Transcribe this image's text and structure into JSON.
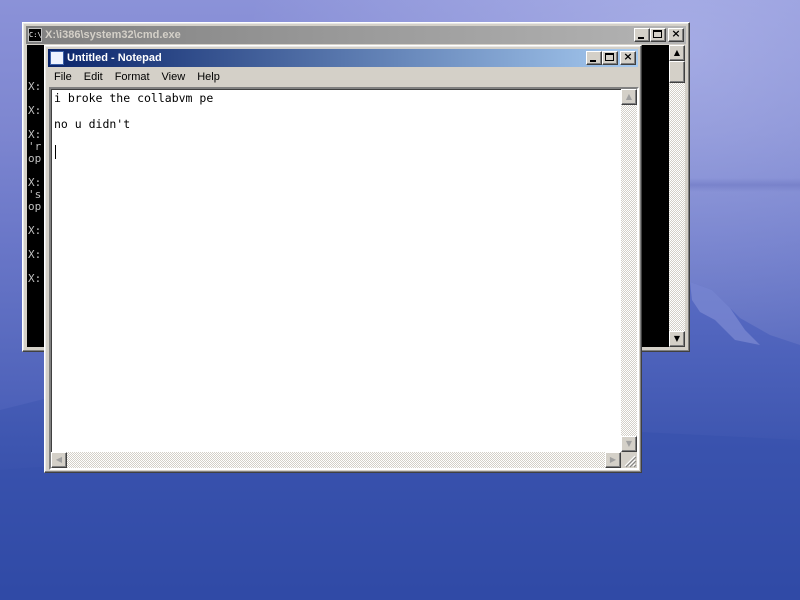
{
  "cmd_window": {
    "title": "X:\\i386\\system32\\cmd.exe",
    "icon": "cmd-icon",
    "console_lines": [
      {
        "text": "X:"
      },
      {
        "text": "X:"
      },
      {
        "text": "X:"
      },
      {
        "text": "'r"
      },
      {
        "text": "op"
      },
      {
        "text": "X:"
      },
      {
        "text": "'s"
      },
      {
        "text": "op"
      },
      {
        "text": "X:"
      },
      {
        "text": "X:"
      },
      {
        "text": "X:"
      }
    ],
    "colors": {
      "background": "#000000",
      "text": "#c0c0c0",
      "titlebar_inactive": "#808080"
    }
  },
  "notepad_window": {
    "title": "Untitled - Notepad",
    "icon": "notepad-icon",
    "menu": [
      "File",
      "Edit",
      "Format",
      "View",
      "Help"
    ],
    "text_lines": [
      "i broke the collabvm pe",
      "",
      "no u didn't",
      ""
    ],
    "colors": {
      "titlebar_active_start": "#0a246a",
      "titlebar_active_end": "#a6caf0",
      "editor_bg": "#ffffff"
    }
  },
  "desktop": {
    "wallpaper": "blue-mountain",
    "colors": {
      "sky": "#7d86d0",
      "mountain": "#2f4aa8"
    }
  }
}
